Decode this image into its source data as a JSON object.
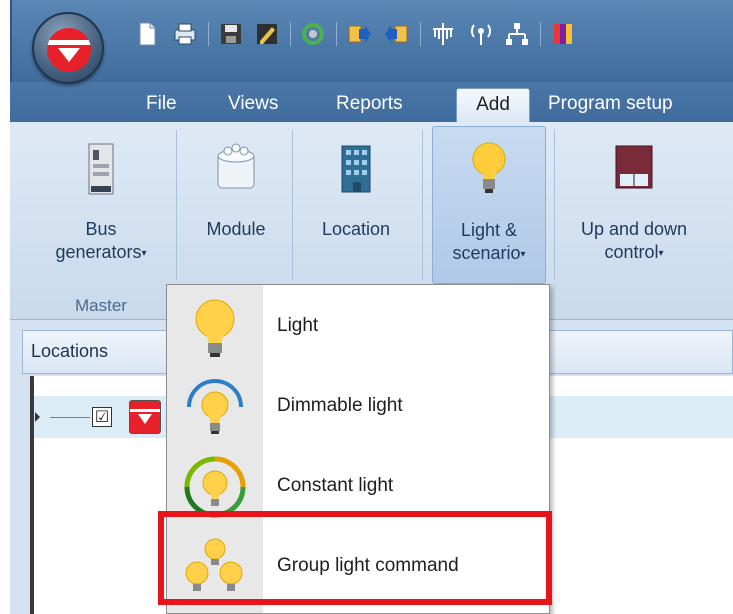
{
  "tabs": [
    {
      "label": "File"
    },
    {
      "label": "Views"
    },
    {
      "label": "Reports"
    },
    {
      "label": "Add"
    },
    {
      "label": "Program setup"
    }
  ],
  "ribbon": {
    "buttons": [
      {
        "label_line1": "Bus",
        "label_line2": "generators",
        "has_dropdown": true,
        "icon": "bus-generator-icon"
      },
      {
        "label_line1": "Module",
        "label_line2": "",
        "has_dropdown": false,
        "icon": "module-icon"
      },
      {
        "label_line1": "Location",
        "label_line2": "",
        "has_dropdown": false,
        "icon": "building-icon"
      },
      {
        "label_line1": "Light &",
        "label_line2": "scenario",
        "has_dropdown": true,
        "icon": "lightbulb-icon"
      },
      {
        "label_line1": "Up and down",
        "label_line2": "control",
        "has_dropdown": true,
        "icon": "window-blind-icon"
      }
    ],
    "group_label": "Master",
    "caret": "▾"
  },
  "panel": {
    "title": "Locations",
    "checkbox_mark": "☑"
  },
  "menu": {
    "items": [
      {
        "label": "Light",
        "icon": "lightbulb-icon"
      },
      {
        "label": "Dimmable light",
        "icon": "dimmable-light-icon"
      },
      {
        "label": "Constant light",
        "icon": "constant-light-icon"
      },
      {
        "label": "Group light command",
        "icon": "group-light-icon"
      }
    ]
  },
  "colors": {
    "highlight": "#e8141c",
    "brand_red": "#e8202a",
    "ribbon_bg": "#dfe9f5",
    "titlebar": "#4a77a7"
  }
}
